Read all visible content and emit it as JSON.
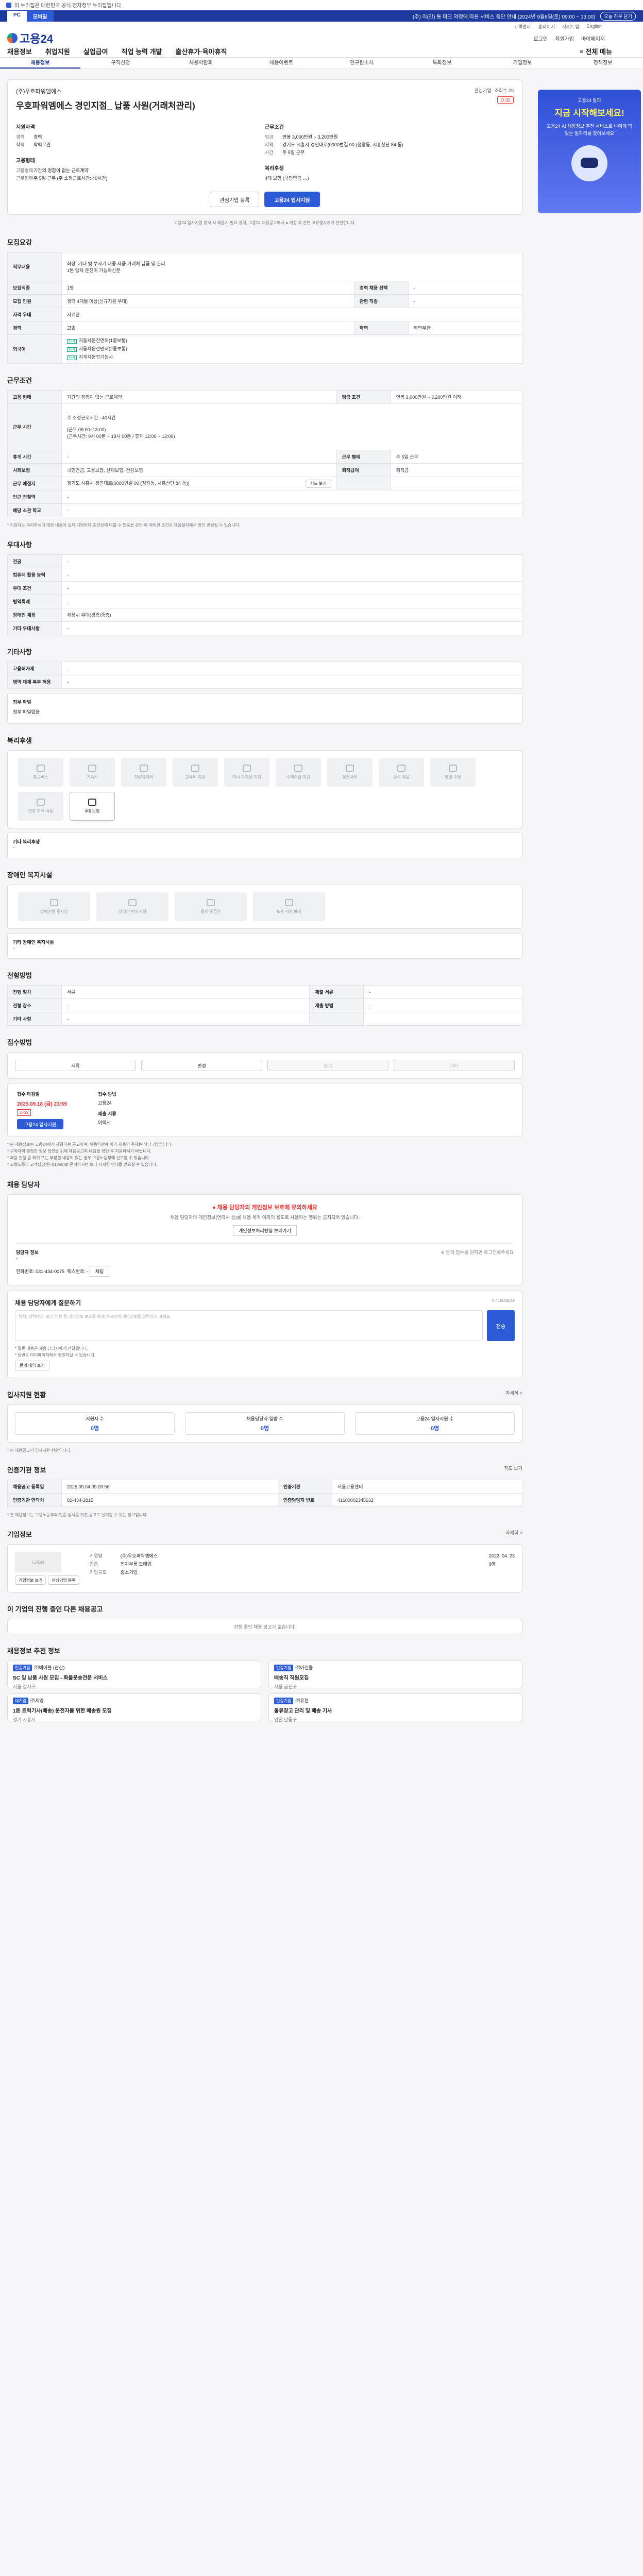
{
  "topbar": {
    "label": "이 누리집은 대한민국 공식 전자정부 누리집입니다."
  },
  "notice": {
    "tab1": "PC",
    "tab2": "모바일",
    "message": "(주) 이(간) 통 마크 약정에 따른 서비스 중단 안내 (2024년 9월6일(토) 09:00 ~ 13:00)",
    "close": "오늘 하루 닫기"
  },
  "util": [
    "고객센터",
    "홈페이지",
    "사이트맵",
    "English"
  ],
  "header": {
    "logo": "고용24",
    "login": "로그인",
    "signup": "회원가입",
    "mypage": "마이페이지"
  },
  "gnb": {
    "items": [
      "채용정보",
      "취업지원",
      "실업급여",
      "직업 능력 개발",
      "출산휴가·육아휴직"
    ],
    "all": "전체 메뉴"
  },
  "lnb": [
    "채용정보",
    "구직신청",
    "채용박람회",
    "채용이벤트",
    "연구원소식",
    "특화정보",
    "기업정보",
    "정책정보"
  ],
  "ad": {
    "t1": "고용24 알파",
    "t2": "지금 시작해보세요!",
    "t3": "고용24 AI 채용정보 추천 서비스로 나에게 딱 맞는 일자리를 찾아보세요"
  },
  "job": {
    "company": "(주)우호파워엠에스",
    "title": "우호파워엠에스 경인지점_ 납품 사원(거래처관리)",
    "views": "조회수 29",
    "interest": "관심기업",
    "dday": "D-32",
    "qual_title": "지원자격",
    "qual": [
      [
        "경력",
        "경력"
      ],
      [
        "학력",
        "학력무관"
      ]
    ],
    "cond_title": "근무조건",
    "cond": [
      [
        "임금",
        "연봉 3,000만원 ~ 3,200만원"
      ],
      [
        "지역",
        "경기도 시흥시 경인대로(0000번길 00 (정왕동, 시흥산단 84 동)"
      ],
      [
        "시간",
        "주 5일 근무"
      ]
    ],
    "work_title": "고용형태",
    "work": [
      [
        "고용형태",
        "기간의 정함이 없는 근로계약"
      ],
      [
        "근무형태",
        "주 5일 근무 (주 소정근로시간: 40시간)"
      ]
    ],
    "welfare_title": "복리후생",
    "welfare": "4대 보험 (국민연금 …)",
    "btn1": "관심기업 등록",
    "btn2": "고용24 입사지원",
    "helper": "고용24 입사지원 방식 시 채용시 필요 경력, 고용24 채용공고에서 ● 계정 후 관련 고유행사자가 관련합니다."
  },
  "recruit": {
    "title": "모집요강",
    "duty_label": "직무내용",
    "duty": "화장, 기타 빛 부자기 대중 제품 거래처 납품 및 관리\n1톤 탑차 운전이 가능하신분",
    "rows": [
      [
        "모집직종",
        "1명",
        "경력 채용 선택",
        "-"
      ],
      [
        "모집 인원",
        "경력 4개월 이상(신규지원 우대)",
        "관련 직종",
        "-"
      ],
      [
        "자격 우대",
        "자료관"
      ],
      [
        "경력",
        "고졸",
        "학력",
        "학력무관"
      ]
    ],
    "lang_label": "외국어",
    "lang": [
      "자동차운전면허(1종보통)",
      "자동차운전면허(2종보통)",
      "지게차운전기능사"
    ]
  },
  "cond": {
    "title": "근무조건",
    "rows": [
      [
        "고용 형태",
        "기간의 정함이 없는 근로계약",
        "임금 조건",
        "연봉 3,000만원 ~ 3,200만원 이하"
      ],
      [
        "근무 시간",
        "주 소정근로시간 : 40시간\n\n(근무 09:00~18:00)\n(근무시간: 9시 00분 ~ 18시 00분 / 휴게 12:00 ~ 13:00)"
      ],
      [
        "휴게 시간",
        "-",
        "근무 형태",
        "주 5일 근무"
      ],
      [
        "사회보험",
        "국민연금, 고용보험, 산재보험, 건강보험",
        "퇴직급여",
        "퇴직금"
      ],
      [
        "근무 예정지",
        "경기도 시흥시 경인대로(0000번길 00 (정왕동, 시흥산단 84 동))",
        "",
        ""
      ],
      [
        "인근 전철역",
        "-"
      ],
      [
        "해당 소관 학교",
        "-"
      ]
    ],
    "map_btn": "지도 보기",
    "note": "* 지원자는 복리후생에 대한 내용이 실제 기업마다 조건상에 다를 수 있음을 감안 예 제외한 조건은 채용절차에서 확인 변경될 수 있습니다."
  },
  "prefer": {
    "title": "우대사항",
    "rows": [
      [
        "전공",
        "-"
      ],
      [
        "컴퓨터 활용 능력",
        "-"
      ],
      [
        "우대 조건",
        "-"
      ],
      [
        "병역특례",
        "-"
      ],
      [
        "장애인 채용",
        "채용시 우대(경증/중증)"
      ],
      [
        "기타 우대사항",
        "-"
      ]
    ]
  },
  "etc": {
    "title": "기타사항",
    "rows": [
      [
        "고용허가제",
        "-"
      ],
      [
        "병역 대체 복무 허용",
        "-"
      ]
    ],
    "file_label": "첨부 파일",
    "file": "첨부 파일없음"
  },
  "welfare": {
    "title": "복리후생",
    "items": [
      "통근버스",
      "기숙사",
      "차량유지비",
      "교육비 지원",
      "자녀 학자금 지원",
      "주택자금 지원",
      "경조사비",
      "중식 제공",
      "명절 수당",
      "연차 자유 사용",
      "4대 보험"
    ],
    "on": [
      10
    ],
    "other_label": "기타 복리후생",
    "other": "-"
  },
  "disability": {
    "title": "장애인 복지시설",
    "items": [
      "장애인용 주차장",
      "장애인 편의시설",
      "휠체어 접근",
      "도움 직원 배치"
    ],
    "other_label": "기타 장애인 복지시설",
    "other": "-"
  },
  "process": {
    "title": "전형방법",
    "rows": [
      [
        "전형 절차",
        "서류",
        "제출 서류",
        "-"
      ],
      [
        "전형 장소",
        "-",
        "제출 방법",
        "-"
      ],
      [
        "기타 사항",
        "-",
        "",
        ""
      ]
    ]
  },
  "method": {
    "title": "접수방법",
    "items": [
      "서류",
      "면접",
      "필기",
      "기타"
    ],
    "off": [
      2,
      3
    ],
    "deadline_label": "접수 마감일",
    "deadline": "2025.09.18 (금) 23:59",
    "dday": "D-32",
    "apply_btn": "고용24 입사지원",
    "way_label": "접수 방법",
    "way": "고용24",
    "docs_label": "제출 서류",
    "docs": "이력서",
    "bullets": [
      "* 본 채용정보는 고용24에서 제공하는 공고이며, 이용약관에 따라 채용의 주체는 해당 기업입니다.",
      "* 구직자의 정확한 정보 확인을 위해 채용공고의 내용을 확인 후 지원하시기 바랍니다.",
      "* 채용 진행 중 허위 또는 부당한 내용이 있는 경우 고용노동부에 신고할 수 있습니다.",
      "* 고용노동부 고객상담센터(1350)로 문의하시면 보다 자세한 안내를 받으실 수 있습니다."
    ]
  },
  "manager": {
    "title": "채용 담당자",
    "warn": "채용 담당자의 개인정보 보호에 유의하세요",
    "p": "채용 담당자의 개인정보(연락처 등)를 채용 목적 이외의 용도로 사용하는 행위는 금지되어 있습니다.",
    "btn": "개인정보처리방침 보러가기",
    "name_label": "담당자 정보",
    "name": "-",
    "phone": "전화번호: 031-434-0075",
    "fax": "팩스번호: -",
    "chat": "채팅",
    "note": "※ 문의 접수를 원하면 로그인해주세요"
  },
  "inquiry": {
    "title": "채용 담당자에게 질문하기",
    "limit": "0 / 1000byte",
    "placeholder": "학력, 경력여부, 희망 연봉 등 개인정보 보호를 위해 게시판에 개인정보를 입력하지 마세요.",
    "send": "전송",
    "notes": [
      "* 질문 내용은 채용 담당자에게 전달됩니다.",
      "* 답변은 마이페이지에서 확인하실 수 있습니다."
    ],
    "q_btn": "문의 내역 보기"
  },
  "applicants": {
    "title": "입사지원 현황",
    "more": "자세히 >",
    "items": [
      [
        "지원자 수",
        "0명"
      ],
      [
        "채용담당자 열람 수",
        "0명"
      ],
      [
        "고용24 입사지원 수",
        "0명"
      ]
    ],
    "note": "* 본 채용공고의 입사지원 현황입니다."
  },
  "cert": {
    "title": "인증기관 정보",
    "rows": [
      [
        "채용공고 등록일",
        "2025.09.04 09:09:56",
        "인증기관",
        "서울고용센터"
      ],
      [
        "인증기관 연락처",
        "02-434-2815",
        "인증담당자 번호",
        "41600002345632"
      ]
    ],
    "btn": "지도 보기",
    "note": "* 본 채용정보는 고용노동부의 인증 심사를 거친 공고로 신뢰할 수 있는 정보입니다."
  },
  "company": {
    "title": "기업정보",
    "more": "자세히 >",
    "logo": "LOGO",
    "rows": [
      [
        "기업명",
        "(주)우호파워엠에스"
      ],
      [
        "업종",
        "전자부품 도매업"
      ],
      [
        "기업규모",
        "중소기업"
      ]
    ],
    "founded": "2022. 04. 23",
    "emp": "9명",
    "btn1": "기업정보 보기",
    "btn2": "관심기업 등록"
  },
  "similar": {
    "title": "이 기업의 진행 중인 다른 채용공고",
    "empty": "진행 중인 채용 공고가 없습니다."
  },
  "recommend": {
    "title": "채용정보 추천 정보",
    "jobs": [
      [
        "인증기업",
        "㈜에이블 (안산)",
        "SC 및 납품 사원 모집 - 화물운송전문 서비스",
        "서울 강서구"
      ],
      [
        "인증기업",
        "㈜아린몰",
        "배송직 직원모집",
        "서울 금천구"
      ],
      [
        "대기업",
        "㈜세영",
        "1톤 트럭기사(배송) 운전자를 위한 배송원 모집",
        "경기 시흥시"
      ],
      [
        "인증기업",
        "㈜유한",
        "물류창고 관리 및 배송 기사",
        "인천 남동구"
      ]
    ]
  }
}
